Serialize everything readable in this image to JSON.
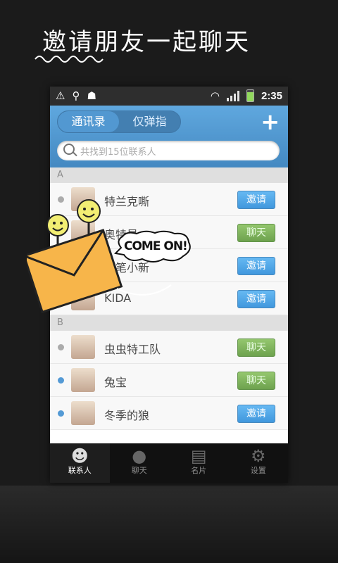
{
  "promo": {
    "title": "邀请朋友一起聊天"
  },
  "status": {
    "time": "2:35"
  },
  "tabs": [
    {
      "label": "通讯录"
    },
    {
      "label": "仅弹指"
    }
  ],
  "search": {
    "placeholder": "共找到15位联系人"
  },
  "sections": [
    {
      "letter": "A",
      "contacts": [
        {
          "name": "特兰克嘶",
          "action": "邀请",
          "online": false
        },
        {
          "name": "奥特曼",
          "action": "聊天",
          "online": false
        },
        {
          "name": "蜡笔小新",
          "action": "邀请",
          "online": false
        },
        {
          "name": "KIDA",
          "action": "邀请",
          "online": false
        }
      ]
    },
    {
      "letter": "B",
      "contacts": [
        {
          "name": "虫虫特工队",
          "action": "聊天",
          "online": false
        },
        {
          "name": "兔宝",
          "action": "聊天",
          "online": true
        },
        {
          "name": "冬季的狼",
          "action": "邀请",
          "online": true
        }
      ]
    }
  ],
  "bottom_tabs": [
    {
      "label": "联系人",
      "icon": "person-icon"
    },
    {
      "label": "聊天",
      "icon": "chat-bubbles-icon"
    },
    {
      "label": "名片",
      "icon": "business-card-icon"
    },
    {
      "label": "设置",
      "icon": "gear-icon"
    }
  ],
  "bubble": {
    "text": "COME ON!"
  },
  "colors": {
    "accent": "#1b6fb4",
    "invite": "#1781d6",
    "chat": "#4e8e28"
  }
}
